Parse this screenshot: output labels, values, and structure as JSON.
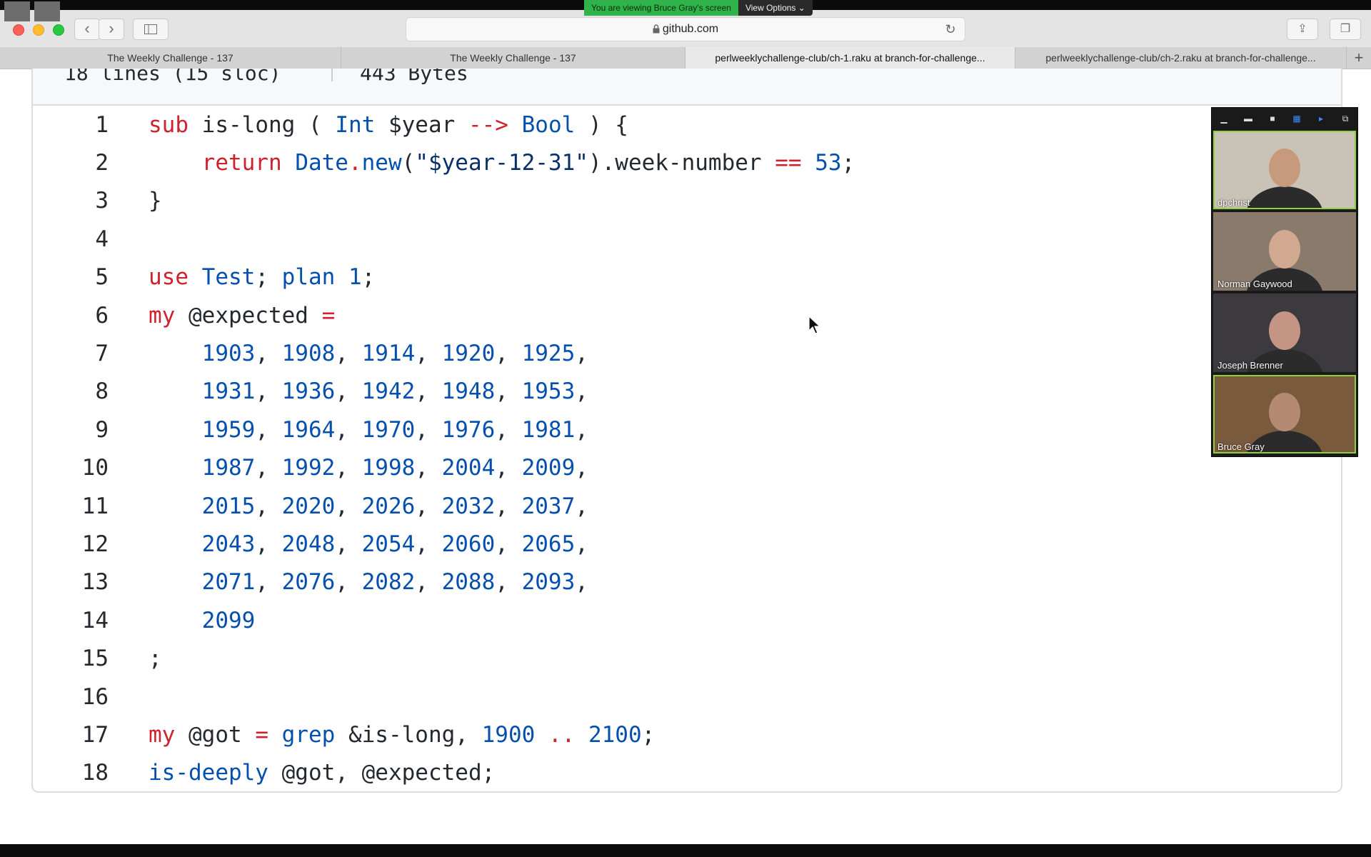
{
  "share_banner": {
    "viewing_text": "You are viewing Bruce Gray's screen",
    "options_label": "View Options"
  },
  "browser": {
    "url": "github.com",
    "tabs": [
      {
        "title": "The Weekly Challenge - 137",
        "active": false
      },
      {
        "title": "The Weekly Challenge - 137",
        "active": false
      },
      {
        "title": "perlweeklychallenge-club/ch-1.raku at branch-for-challenge...",
        "active": true
      },
      {
        "title": "perlweeklychallenge-club/ch-2.raku at branch-for-challenge...",
        "active": false
      }
    ]
  },
  "code_header": {
    "fragment_left": "18 lines (15 sloc)",
    "fragment_right": "443 Bytes"
  },
  "code_lines": [
    {
      "n": "1",
      "t": "sub is-long ( Int $year --> Bool ) {"
    },
    {
      "n": "2",
      "t": "    return Date.new(\"$year-12-31\").week-number == 53;"
    },
    {
      "n": "3",
      "t": "}"
    },
    {
      "n": "4",
      "t": ""
    },
    {
      "n": "5",
      "t": "use Test; plan 1;"
    },
    {
      "n": "6",
      "t": "my @expected ="
    },
    {
      "n": "7",
      "t": "    1903, 1908, 1914, 1920, 1925,"
    },
    {
      "n": "8",
      "t": "    1931, 1936, 1942, 1948, 1953,"
    },
    {
      "n": "9",
      "t": "    1959, 1964, 1970, 1976, 1981,"
    },
    {
      "n": "10",
      "t": "    1987, 1992, 1998, 2004, 2009,"
    },
    {
      "n": "11",
      "t": "    2015, 2020, 2026, 2032, 2037,"
    },
    {
      "n": "12",
      "t": "    2043, 2048, 2054, 2060, 2065,"
    },
    {
      "n": "13",
      "t": "    2071, 2076, 2082, 2088, 2093,"
    },
    {
      "n": "14",
      "t": "    2099"
    },
    {
      "n": "15",
      "t": ";"
    },
    {
      "n": "16",
      "t": ""
    },
    {
      "n": "17",
      "t": "my @got = grep &is-long, 1900 .. 2100;"
    },
    {
      "n": "18",
      "t": "is-deeply @got, @expected;"
    }
  ],
  "highlight": {
    "line": "2",
    "text": ".week-number"
  },
  "participants": [
    {
      "name": "dpchrist",
      "active": true,
      "bg": "#c9c2b6",
      "skin": "#c79a7e"
    },
    {
      "name": "Norman Gaywood",
      "active": false,
      "bg": "#8a7a6c",
      "skin": "#d1a890"
    },
    {
      "name": "Joseph Brenner",
      "active": false,
      "bg": "#3c3a3e",
      "skin": "#c49584"
    },
    {
      "name": "Bruce Gray",
      "active": true,
      "bg": "#7a5a3c",
      "skin": "#b58a72"
    }
  ],
  "colors": {
    "keyword": "#cf222e",
    "function": "#0550ae",
    "selection": "#b4d5fe",
    "active_speaker": "#8ed13a",
    "banner_green": "#2fb34a"
  }
}
